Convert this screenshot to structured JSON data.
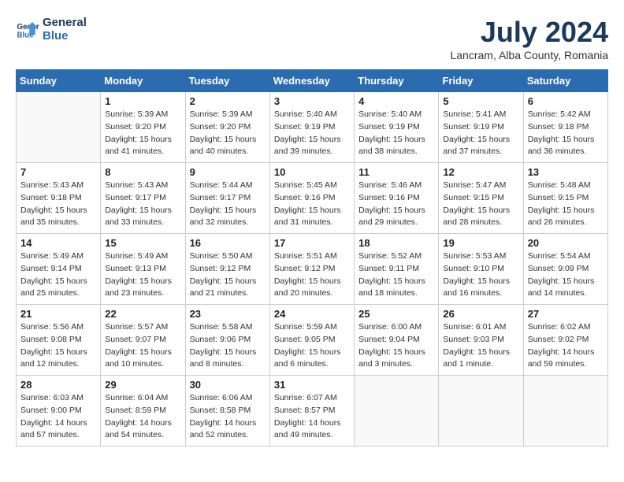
{
  "header": {
    "logo_line1": "General",
    "logo_line2": "Blue",
    "month_year": "July 2024",
    "location": "Lancram, Alba County, Romania"
  },
  "weekdays": [
    "Sunday",
    "Monday",
    "Tuesday",
    "Wednesday",
    "Thursday",
    "Friday",
    "Saturday"
  ],
  "weeks": [
    [
      {
        "day": "",
        "info": ""
      },
      {
        "day": "1",
        "info": "Sunrise: 5:39 AM\nSunset: 9:20 PM\nDaylight: 15 hours\nand 41 minutes."
      },
      {
        "day": "2",
        "info": "Sunrise: 5:39 AM\nSunset: 9:20 PM\nDaylight: 15 hours\nand 40 minutes."
      },
      {
        "day": "3",
        "info": "Sunrise: 5:40 AM\nSunset: 9:19 PM\nDaylight: 15 hours\nand 39 minutes."
      },
      {
        "day": "4",
        "info": "Sunrise: 5:40 AM\nSunset: 9:19 PM\nDaylight: 15 hours\nand 38 minutes."
      },
      {
        "day": "5",
        "info": "Sunrise: 5:41 AM\nSunset: 9:19 PM\nDaylight: 15 hours\nand 37 minutes."
      },
      {
        "day": "6",
        "info": "Sunrise: 5:42 AM\nSunset: 9:18 PM\nDaylight: 15 hours\nand 36 minutes."
      }
    ],
    [
      {
        "day": "7",
        "info": "Sunrise: 5:43 AM\nSunset: 9:18 PM\nDaylight: 15 hours\nand 35 minutes."
      },
      {
        "day": "8",
        "info": "Sunrise: 5:43 AM\nSunset: 9:17 PM\nDaylight: 15 hours\nand 33 minutes."
      },
      {
        "day": "9",
        "info": "Sunrise: 5:44 AM\nSunset: 9:17 PM\nDaylight: 15 hours\nand 32 minutes."
      },
      {
        "day": "10",
        "info": "Sunrise: 5:45 AM\nSunset: 9:16 PM\nDaylight: 15 hours\nand 31 minutes."
      },
      {
        "day": "11",
        "info": "Sunrise: 5:46 AM\nSunset: 9:16 PM\nDaylight: 15 hours\nand 29 minutes."
      },
      {
        "day": "12",
        "info": "Sunrise: 5:47 AM\nSunset: 9:15 PM\nDaylight: 15 hours\nand 28 minutes."
      },
      {
        "day": "13",
        "info": "Sunrise: 5:48 AM\nSunset: 9:15 PM\nDaylight: 15 hours\nand 26 minutes."
      }
    ],
    [
      {
        "day": "14",
        "info": "Sunrise: 5:49 AM\nSunset: 9:14 PM\nDaylight: 15 hours\nand 25 minutes."
      },
      {
        "day": "15",
        "info": "Sunrise: 5:49 AM\nSunset: 9:13 PM\nDaylight: 15 hours\nand 23 minutes."
      },
      {
        "day": "16",
        "info": "Sunrise: 5:50 AM\nSunset: 9:12 PM\nDaylight: 15 hours\nand 21 minutes."
      },
      {
        "day": "17",
        "info": "Sunrise: 5:51 AM\nSunset: 9:12 PM\nDaylight: 15 hours\nand 20 minutes."
      },
      {
        "day": "18",
        "info": "Sunrise: 5:52 AM\nSunset: 9:11 PM\nDaylight: 15 hours\nand 18 minutes."
      },
      {
        "day": "19",
        "info": "Sunrise: 5:53 AM\nSunset: 9:10 PM\nDaylight: 15 hours\nand 16 minutes."
      },
      {
        "day": "20",
        "info": "Sunrise: 5:54 AM\nSunset: 9:09 PM\nDaylight: 15 hours\nand 14 minutes."
      }
    ],
    [
      {
        "day": "21",
        "info": "Sunrise: 5:56 AM\nSunset: 9:08 PM\nDaylight: 15 hours\nand 12 minutes."
      },
      {
        "day": "22",
        "info": "Sunrise: 5:57 AM\nSunset: 9:07 PM\nDaylight: 15 hours\nand 10 minutes."
      },
      {
        "day": "23",
        "info": "Sunrise: 5:58 AM\nSunset: 9:06 PM\nDaylight: 15 hours\nand 8 minutes."
      },
      {
        "day": "24",
        "info": "Sunrise: 5:59 AM\nSunset: 9:05 PM\nDaylight: 15 hours\nand 6 minutes."
      },
      {
        "day": "25",
        "info": "Sunrise: 6:00 AM\nSunset: 9:04 PM\nDaylight: 15 hours\nand 3 minutes."
      },
      {
        "day": "26",
        "info": "Sunrise: 6:01 AM\nSunset: 9:03 PM\nDaylight: 15 hours\nand 1 minute."
      },
      {
        "day": "27",
        "info": "Sunrise: 6:02 AM\nSunset: 9:02 PM\nDaylight: 14 hours\nand 59 minutes."
      }
    ],
    [
      {
        "day": "28",
        "info": "Sunrise: 6:03 AM\nSunset: 9:00 PM\nDaylight: 14 hours\nand 57 minutes."
      },
      {
        "day": "29",
        "info": "Sunrise: 6:04 AM\nSunset: 8:59 PM\nDaylight: 14 hours\nand 54 minutes."
      },
      {
        "day": "30",
        "info": "Sunrise: 6:06 AM\nSunset: 8:58 PM\nDaylight: 14 hours\nand 52 minutes."
      },
      {
        "day": "31",
        "info": "Sunrise: 6:07 AM\nSunset: 8:57 PM\nDaylight: 14 hours\nand 49 minutes."
      },
      {
        "day": "",
        "info": ""
      },
      {
        "day": "",
        "info": ""
      },
      {
        "day": "",
        "info": ""
      }
    ]
  ]
}
